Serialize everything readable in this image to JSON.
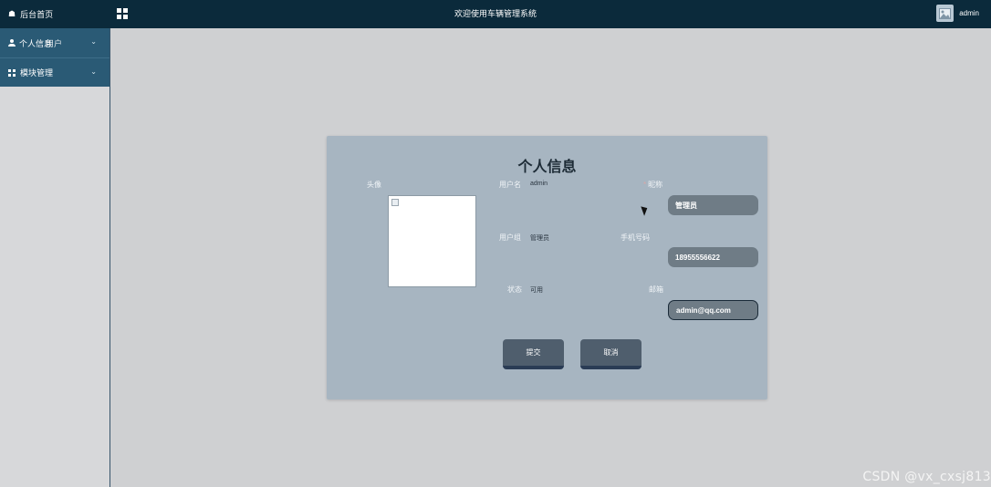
{
  "topbar": {
    "home_label": "后台首页",
    "title": "欢迎使用车辆管理系统",
    "username": "admin"
  },
  "sidebar": {
    "items": [
      {
        "label": "个人信息",
        "overlay_label": "用户",
        "icon": "user-icon",
        "expandable": true
      },
      {
        "label": "模块管理",
        "icon": "grid-icon",
        "expandable": true
      }
    ]
  },
  "form": {
    "title": "个人信息",
    "avatar_label": "头像",
    "username_label": "用户名",
    "username_value": "admin",
    "role_label": "用户组",
    "role_value": "管理员",
    "status_label": "状态",
    "status_value": "可用",
    "nickname_label": "昵称",
    "nickname_required": "*",
    "nickname_value": "管理员",
    "phone_label": "手机号码",
    "phone_value": "18955556622",
    "email_label": "邮箱",
    "email_value": "admin@qq.com"
  },
  "buttons": {
    "submit": "提交",
    "cancel": "取消"
  },
  "watermark": "CSDN @vx_cxsj813",
  "colors": {
    "topbar": "#0b2a3b",
    "sidebar_menu": "#2a5a75",
    "panel": "#a7b5c1",
    "input": "#6f7c86",
    "button": "#4f5e6d"
  }
}
